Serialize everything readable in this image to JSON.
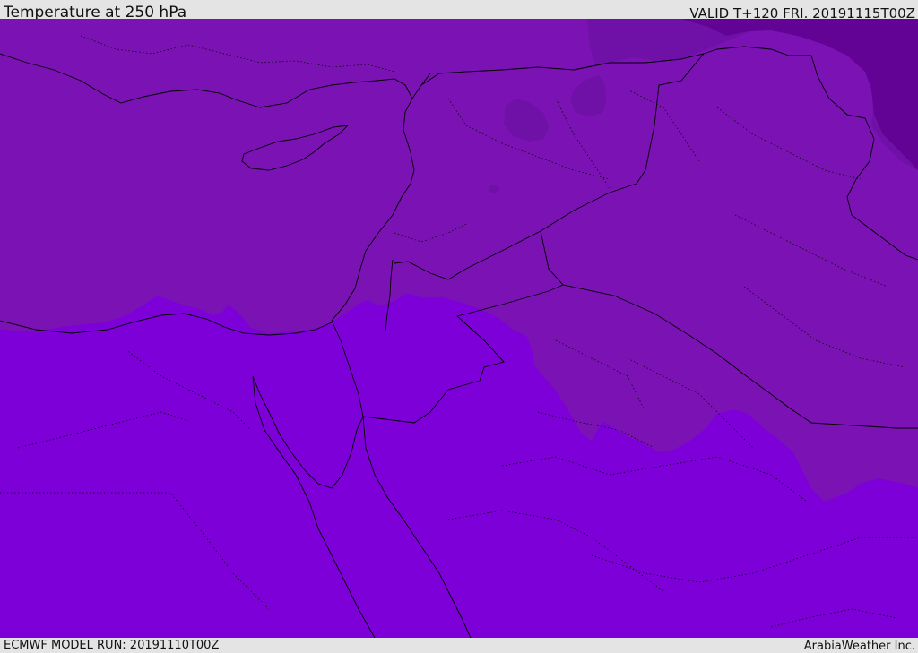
{
  "header": {
    "title": "Temperature at 250 hPa",
    "valid": "VALID T+120 FRI. 20191115T00Z"
  },
  "footer": {
    "model_run": "ECMWF MODEL RUN: 20191110T00Z",
    "credit": "ArabiaWeather Inc."
  },
  "colors": {
    "band_warmest": "#7d00d9",
    "band_middle": "#7b12b4",
    "band_cold": "#6f10a6",
    "band_coldest": "#620396",
    "border_line": "#000000",
    "bar_background": "#e4e4e4"
  }
}
